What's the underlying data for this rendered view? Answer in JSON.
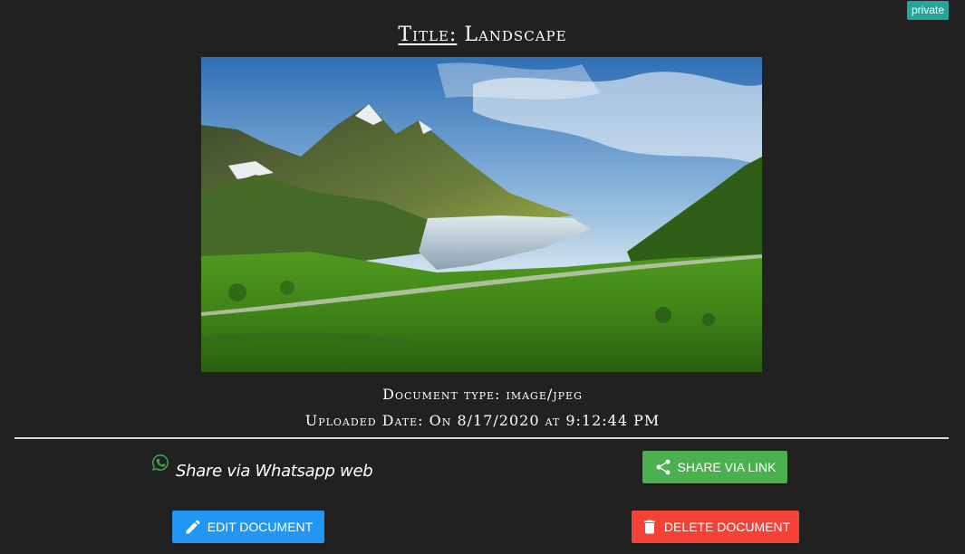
{
  "badge": {
    "label": "private"
  },
  "header": {
    "title_label": "Title:",
    "title_value": "Landscape"
  },
  "document": {
    "type_text": "Document type: image/jpeg",
    "uploaded_text": "Uploaded Date: On 8/17/2020 at 9:12:44 PM"
  },
  "share": {
    "whatsapp_label": "Share via Whatsapp web",
    "link_label": "SHARE VIA LINK"
  },
  "actions": {
    "edit_label": "EDIT DOCUMENT",
    "delete_label": "DELETE DOCUMENT"
  },
  "icons": {
    "whatsapp": "whatsapp-icon",
    "share": "share-icon",
    "edit": "pencil-icon",
    "delete": "trash-icon"
  },
  "colors": {
    "background": "#212121",
    "badge": "#26a69a",
    "whatsapp": "#43a047",
    "share_button": "#4caf50",
    "edit_button": "#2196f3",
    "delete_button": "#f44336"
  }
}
